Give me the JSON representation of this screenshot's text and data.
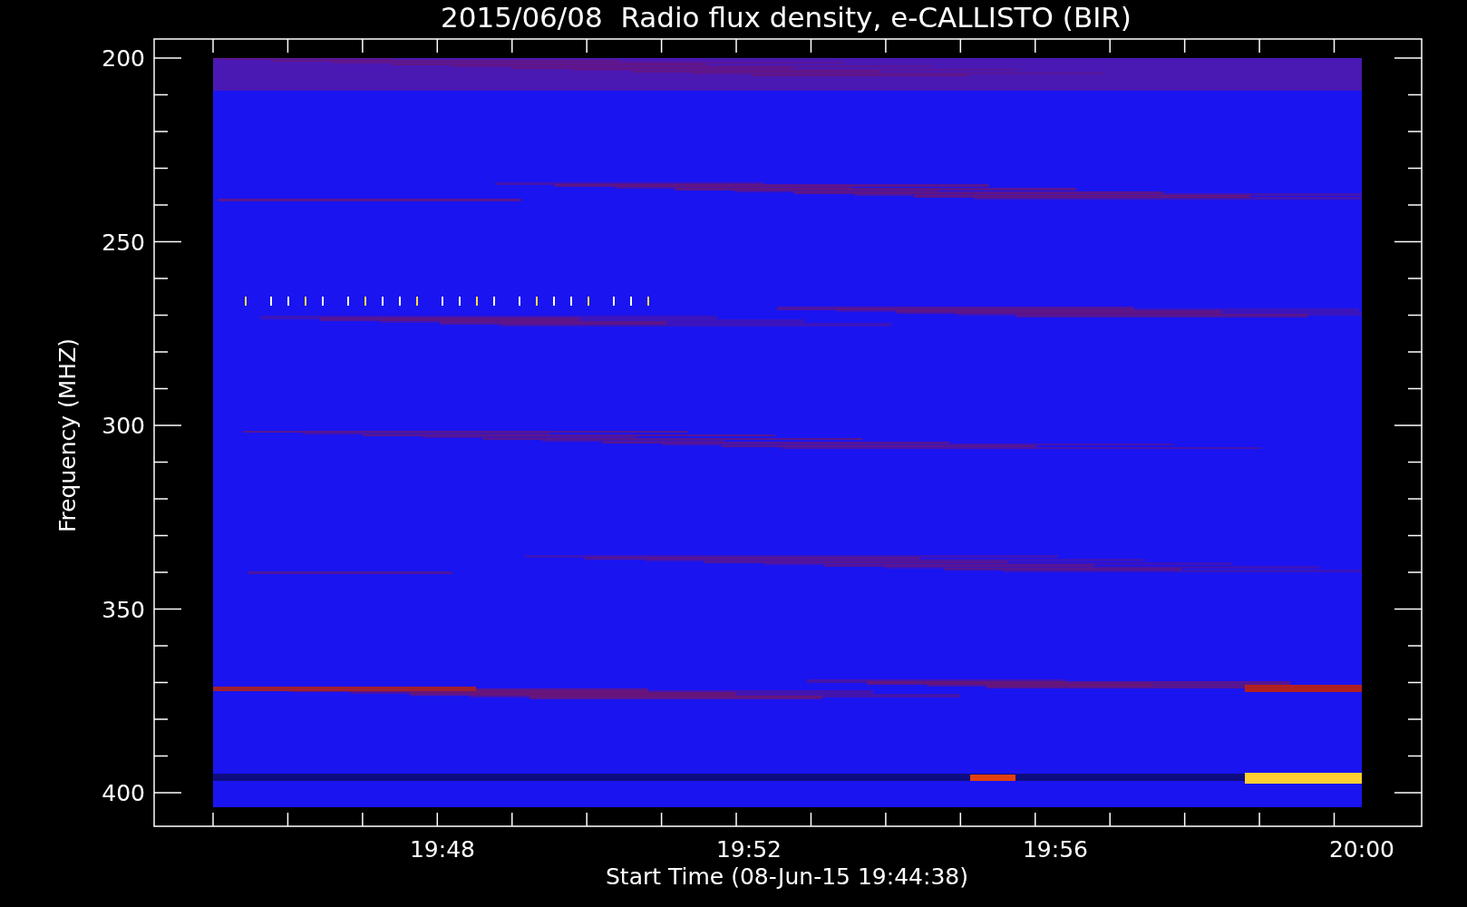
{
  "title": "2015/06/08  Radio flux density, e-CALLISTO (BIR)",
  "y_axis": {
    "label": "Frequency (MHZ)",
    "ticks": [
      "200",
      "250",
      "300",
      "350",
      "400"
    ]
  },
  "x_axis": {
    "label": "Start Time (08-Jun-15 19:44:38)",
    "ticks": [
      "19:48",
      "19:52",
      "19:56",
      "20:00"
    ]
  }
}
